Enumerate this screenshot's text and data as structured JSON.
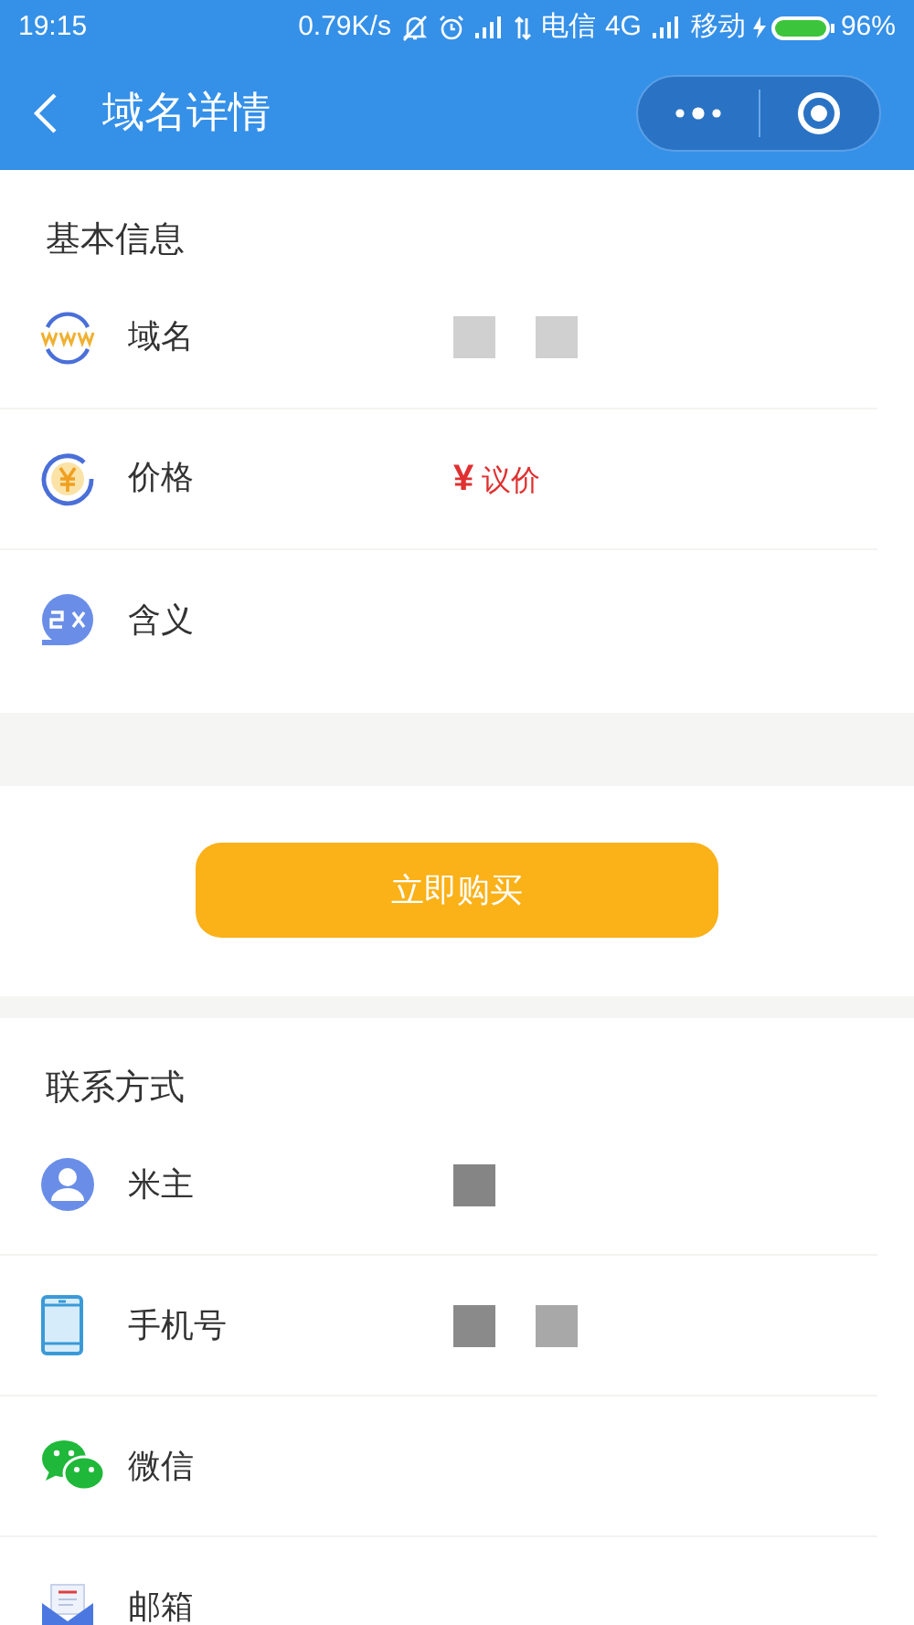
{
  "status_bar": {
    "time": "19:15",
    "speed": "0.79K/s",
    "carrier_1": "电信",
    "network_1": "4G",
    "carrier_2": "移动",
    "battery": "96%"
  },
  "nav_bar": {
    "title": "域名详情"
  },
  "basic_info": {
    "title": "基本信息",
    "rows": [
      {
        "label": "域名",
        "kind": "masked",
        "masks": [
          {
            "color": "#d0d0d0"
          },
          {
            "color": "#d0d0d0"
          }
        ]
      },
      {
        "label": "价格",
        "kind": "price",
        "currency": "¥",
        "value": "议价"
      },
      {
        "label": "含义",
        "kind": "empty"
      }
    ]
  },
  "buy_button": {
    "label": "立即购买"
  },
  "contact": {
    "title": "联系方式",
    "rows": [
      {
        "label": "米主",
        "kind": "masked",
        "masks": [
          {
            "color": "#858585"
          }
        ]
      },
      {
        "label": "手机号",
        "kind": "masked",
        "masks": [
          {
            "color": "#8a8a8a"
          },
          {
            "color": "#a8a8a8"
          }
        ]
      },
      {
        "label": "微信",
        "kind": "empty"
      },
      {
        "label": "邮箱",
        "kind": "empty"
      }
    ]
  }
}
